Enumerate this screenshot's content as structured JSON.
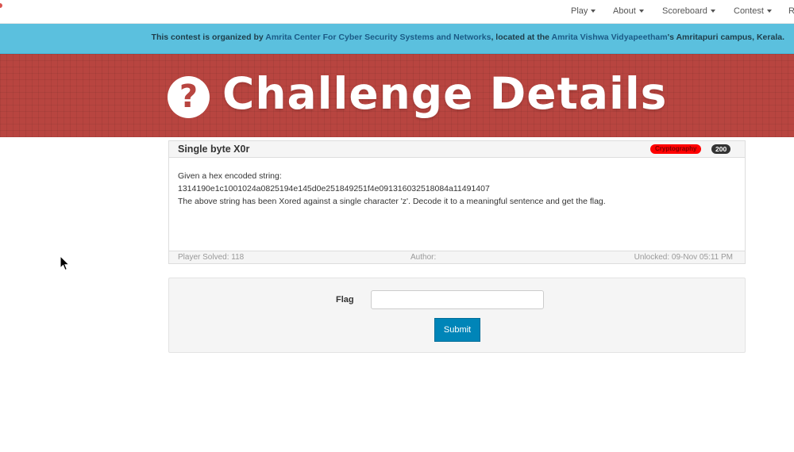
{
  "nav": {
    "items": [
      {
        "label": "Play"
      },
      {
        "label": "About"
      },
      {
        "label": "Scoreboard"
      },
      {
        "label": "Contest"
      },
      {
        "label": "R"
      }
    ]
  },
  "infobar": {
    "prefix": "This contest is organized by ",
    "org_link": "Amrita Center For Cyber Security Systems and Networks",
    "middle": ", located at the ",
    "univ_link": "Amrita Vishwa Vidyapeetham",
    "suffix": "'s Amritapuri campus, Kerala."
  },
  "hero": {
    "icon": "?",
    "icon_name": "question-circle-icon",
    "title": "Challenge Details"
  },
  "challenge": {
    "title": "Single byte X0r",
    "category": "Cryptography",
    "points": "200",
    "description": [
      "Given a hex encoded string:",
      "1314190e1c1001024a0825194e145d0e251849251f4e091316032518084a11491407",
      "The above string has been Xored against a single character 'z'. Decode it to a meaningful sentence and get the flag."
    ],
    "footer": {
      "solved": "Player Solved: 118",
      "author": "Author:",
      "unlocked": "Unlocked: 09-Nov 05:11 PM"
    }
  },
  "flag_form": {
    "label": "Flag",
    "input_value": "",
    "submit_label": "Submit"
  },
  "colors": {
    "hero_bg": "#b84540",
    "infobar_bg": "#5bc0de",
    "submit_bg": "#0085b8",
    "category_badge": "#ff0000"
  }
}
